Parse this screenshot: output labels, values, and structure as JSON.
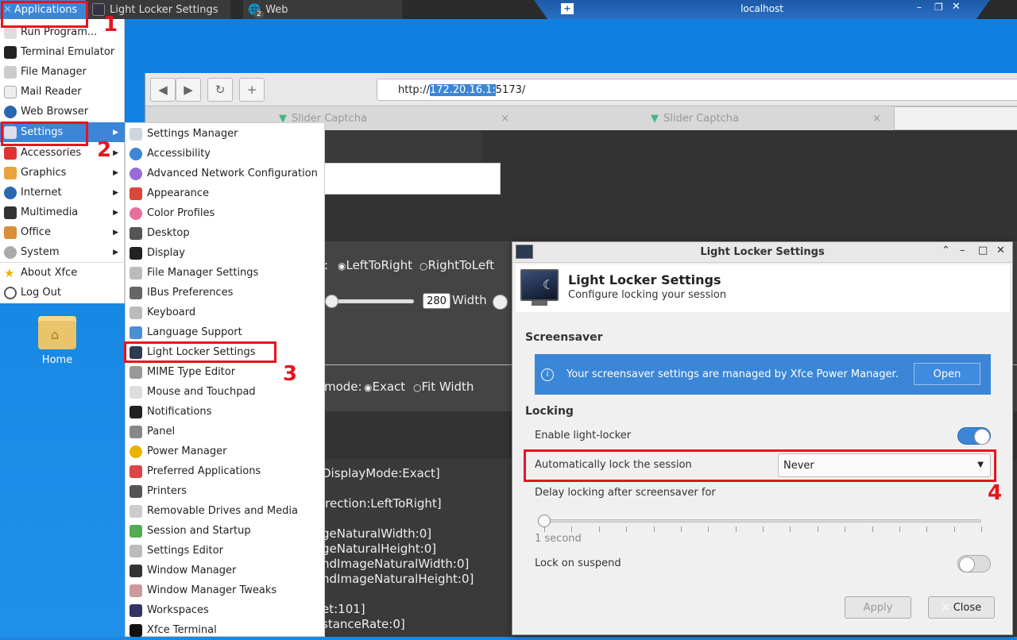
{
  "panel": {
    "applications_label": "Applications",
    "task_light_locker": "Light Locker Settings",
    "task_web": "Web",
    "task_web_count": "2",
    "remote_title": "localhost"
  },
  "browser": {
    "url_prefix": "http://",
    "url_highlight": "172.20.16.1:",
    "url_suffix": "5173/",
    "tabs": [
      "Slider Captcha",
      "Slider Captcha"
    ],
    "page_lines": {
      "direction_label": ":",
      "direction_opt1": "LeftToRight",
      "direction_opt2": "RightToLeft",
      "width_value": "280",
      "width_label": "Width",
      "mode_label": "mode:",
      "mode_opt1": "Exact",
      "mode_opt2": "Fit Width",
      "log": [
        "DisplayMode:Exact]",
        "irection:LeftToRight]",
        "geNaturalWidth:0]",
        "geNaturalHeight:0]",
        "ndImageNaturalWidth:0]",
        "ndImageNaturalHeight:0]",
        "et:101]",
        "stanceRate:0]"
      ]
    }
  },
  "app_menu": {
    "items": [
      {
        "label": "Run Program...",
        "icon": "run-icon"
      },
      {
        "label": "Terminal Emulator",
        "icon": "terminal-icon"
      },
      {
        "label": "File Manager",
        "icon": "folder-icon"
      },
      {
        "label": "Mail Reader",
        "icon": "mail-icon"
      },
      {
        "label": "Web Browser",
        "icon": "globe-icon"
      },
      {
        "label": "Settings",
        "icon": "settings-icon"
      },
      {
        "label": "Accessories",
        "icon": "accessories-icon"
      },
      {
        "label": "Graphics",
        "icon": "graphics-icon"
      },
      {
        "label": "Internet",
        "icon": "internet-icon"
      },
      {
        "label": "Multimedia",
        "icon": "multimedia-icon"
      },
      {
        "label": "Office",
        "icon": "office-icon"
      },
      {
        "label": "System",
        "icon": "system-icon"
      },
      {
        "label": "About Xfce",
        "icon": "star-icon"
      },
      {
        "label": "Log Out",
        "icon": "power-icon"
      }
    ]
  },
  "settings_menu": {
    "items": [
      "Settings Manager",
      "Accessibility",
      "Advanced Network Configuration",
      "Appearance",
      "Color Profiles",
      "Desktop",
      "Display",
      "File Manager Settings",
      "IBus Preferences",
      "Keyboard",
      "Language Support",
      "Light Locker Settings",
      "MIME Type Editor",
      "Mouse and Touchpad",
      "Notifications",
      "Panel",
      "Power Manager",
      "Preferred Applications",
      "Printers",
      "Removable Drives and Media",
      "Session and Startup",
      "Settings Editor",
      "Window Manager",
      "Window Manager Tweaks",
      "Workspaces",
      "Xfce Terminal"
    ]
  },
  "desktop": {
    "home_label": "Home"
  },
  "annotations": [
    "1",
    "2",
    "3",
    "4"
  ],
  "dialog": {
    "window_title": "Light Locker Settings",
    "header_title": "Light Locker Settings",
    "header_subtitle": "Configure locking your session",
    "screensaver_section": "Screensaver",
    "info_text": "Your screensaver settings are managed by Xfce Power Manager.",
    "open_label": "Open",
    "locking_section": "Locking",
    "enable_label": "Enable light-locker",
    "enable_on": true,
    "autolock_label": "Automatically lock the session",
    "autolock_value": "Never",
    "delay_label": "Delay locking after screensaver for",
    "delay_value_text": "1 second",
    "delay_fraction": 0,
    "suspend_label": "Lock on suspend",
    "suspend_on": false,
    "apply_label": "Apply",
    "close_label": "Close"
  },
  "colors": {
    "accent": "#3b86d6",
    "annotation": "#e8141e"
  }
}
